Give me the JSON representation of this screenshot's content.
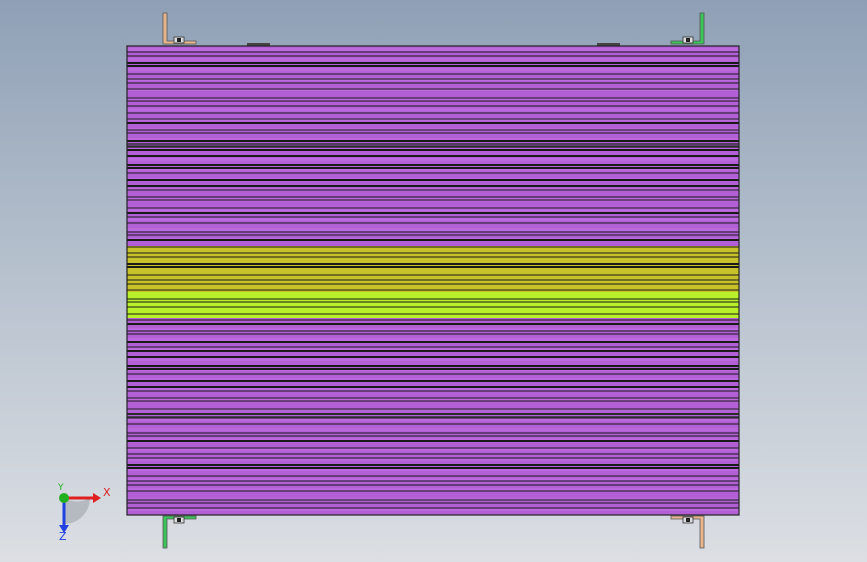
{
  "viewport": {
    "background_top": "#8fa0b6",
    "background_bottom": "#dcdfe4"
  },
  "model": {
    "purple_color": "#b35fd6",
    "purple_alt_color": "#c06fe0",
    "olive_color": "#c8c22a",
    "lime_color": "#b8f02a",
    "line_color": "#1a1a1a",
    "bracket_colors": {
      "top_left": "#e8b48c",
      "top_right": "#3cc35a",
      "bottom_left": "#3cc35a",
      "bottom_right": "#e8b48c"
    }
  },
  "triad": {
    "x_label": "X",
    "y_label": "Y",
    "z_label": "Z",
    "x_color": "#e02020",
    "y_color": "#20b020",
    "z_color": "#2040e0"
  }
}
